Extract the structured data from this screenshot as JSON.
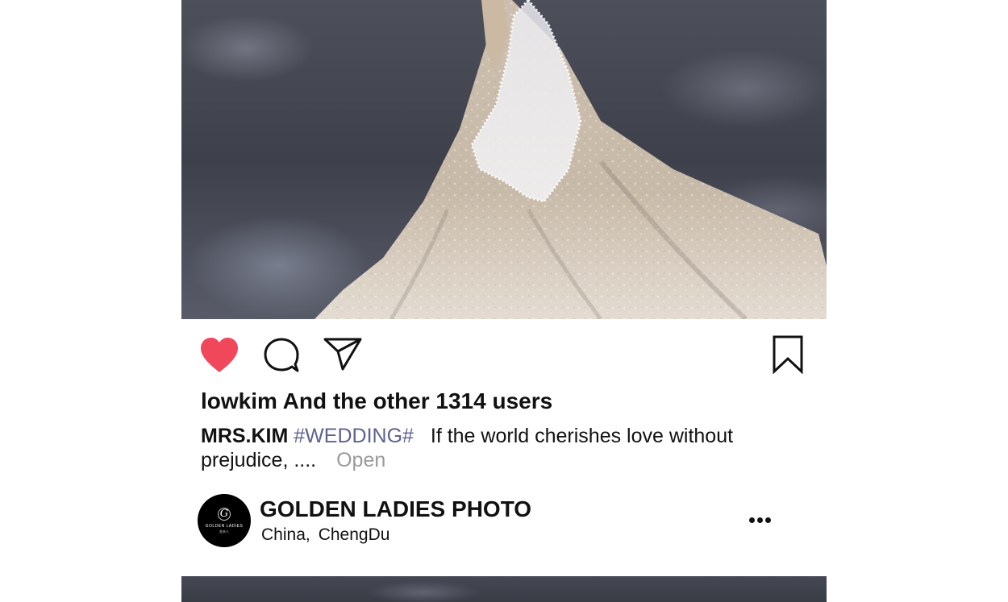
{
  "post": {
    "likes_text": "lowkim And the other 1314 users",
    "caption": {
      "username": "MRS.KIM",
      "hashtag": "#WEDDING#",
      "text_line1": "If the world cherishes love without",
      "text_line2": "prejudice, ....",
      "more_label": "Open"
    },
    "account": {
      "name": "GOLDEN LADIES PHOTO",
      "location_country": "China,",
      "location_city": "ChengDu",
      "avatar": {
        "logo_title": "GOLDEN LADIES",
        "logo_sub": "金夫人"
      }
    },
    "actions": {
      "like_icon": "heart-filled-icon",
      "comment_icon": "comment-bubble-icon",
      "share_icon": "paper-plane-icon",
      "save_icon": "bookmark-icon",
      "like_color": "#f0485a"
    }
  },
  "colors": {
    "hashtag": "#5d628f",
    "more": "#9a9a9a",
    "text": "#111111"
  }
}
